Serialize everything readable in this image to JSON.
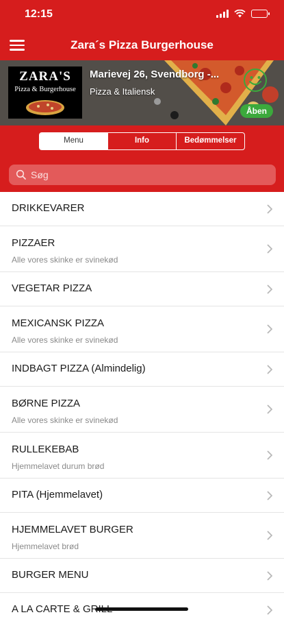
{
  "status_bar": {
    "time": "12:15"
  },
  "nav": {
    "title": "Zara´s Pizza Burgerhouse",
    "menu_icon": "hamburger-menu-icon"
  },
  "restaurant": {
    "logo_line1": "ZARA'S",
    "logo_line2": "Pizza & Burgerhouse",
    "address": "Marievej 26, Svendborg -...",
    "category": "Pizza & Italiensk",
    "smiley_icon": "elite-smiley-icon",
    "open_status": "Åben",
    "open_color": "#3ca93c"
  },
  "tabs": [
    {
      "label": "Menu",
      "active": true
    },
    {
      "label": "Info",
      "active": false
    },
    {
      "label": "Bedømmelser",
      "active": false
    }
  ],
  "search": {
    "placeholder": "Søg"
  },
  "menu_items": [
    {
      "title": "DRIKKEVARER",
      "subtitle": ""
    },
    {
      "title": "PIZZAER",
      "subtitle": "Alle vores skinke er svinekød"
    },
    {
      "title": "VEGETAR PIZZA",
      "subtitle": ""
    },
    {
      "title": "MEXICANSK PIZZA",
      "subtitle": "Alle vores skinke er svinekød"
    },
    {
      "title": "INDBAGT PIZZA (Almindelig)",
      "subtitle": ""
    },
    {
      "title": "BØRNE PIZZA",
      "subtitle": "Alle vores skinke er svinekød"
    },
    {
      "title": "RULLEKEBAB",
      "subtitle": "Hjemmelavet durum brød"
    },
    {
      "title": "PITA (Hjemmelavet)",
      "subtitle": ""
    },
    {
      "title": "HJEMMELAVET BURGER",
      "subtitle": "Hjemmelavet brød"
    },
    {
      "title": "BURGER MENU",
      "subtitle": ""
    },
    {
      "title": "A LA CARTE & GRILL",
      "subtitle": ""
    }
  ],
  "colors": {
    "brand_red": "#d61d1d",
    "search_bg": "#e35a5a"
  }
}
